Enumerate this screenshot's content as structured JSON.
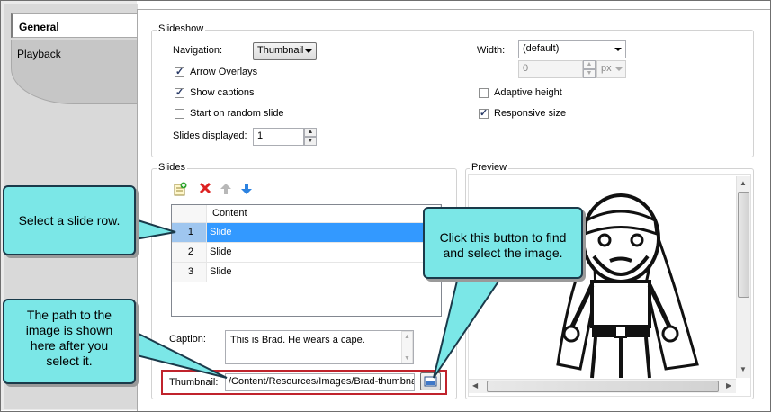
{
  "tabs": [
    {
      "label": "General",
      "selected": true
    },
    {
      "label": "Playback",
      "selected": false
    }
  ],
  "slideshow": {
    "group_label": "Slideshow",
    "navigation_label": "Navigation:",
    "navigation_value": "Thumbnail",
    "arrow_overlays": {
      "label": "Arrow Overlays",
      "checked": true
    },
    "show_captions": {
      "label": "Show captions",
      "checked": true
    },
    "random_start": {
      "label": "Start on random slide",
      "checked": false
    },
    "slides_displayed_label": "Slides displayed:",
    "slides_displayed_value": "1",
    "width_label": "Width:",
    "width_value": "(default)",
    "width_number": "0",
    "width_unit": "px",
    "adaptive_height": {
      "label": "Adaptive height",
      "checked": false
    },
    "responsive_size": {
      "label": "Responsive size",
      "checked": true
    }
  },
  "slides": {
    "group_label": "Slides",
    "column_header": "Content",
    "rows": [
      {
        "num": "1",
        "content": "Slide"
      },
      {
        "num": "2",
        "content": "Slide"
      },
      {
        "num": "3",
        "content": "Slide"
      }
    ],
    "caption_label": "Caption:",
    "caption_value": "This is Brad. He wears a cape.",
    "thumbnail_label": "Thumbnail:",
    "thumbnail_value": "/Content/Resources/Images/Brad-thumbna"
  },
  "preview": {
    "group_label": "Preview"
  },
  "callouts": {
    "select_row": "Select a slide row.",
    "path": "The path to the image is shown here after you select it.",
    "button": "Click this button to find and select the image."
  },
  "colors": {
    "callout_fill": "#7be7e7",
    "selection": "#3399ff",
    "highlight_border": "#c0232c"
  }
}
